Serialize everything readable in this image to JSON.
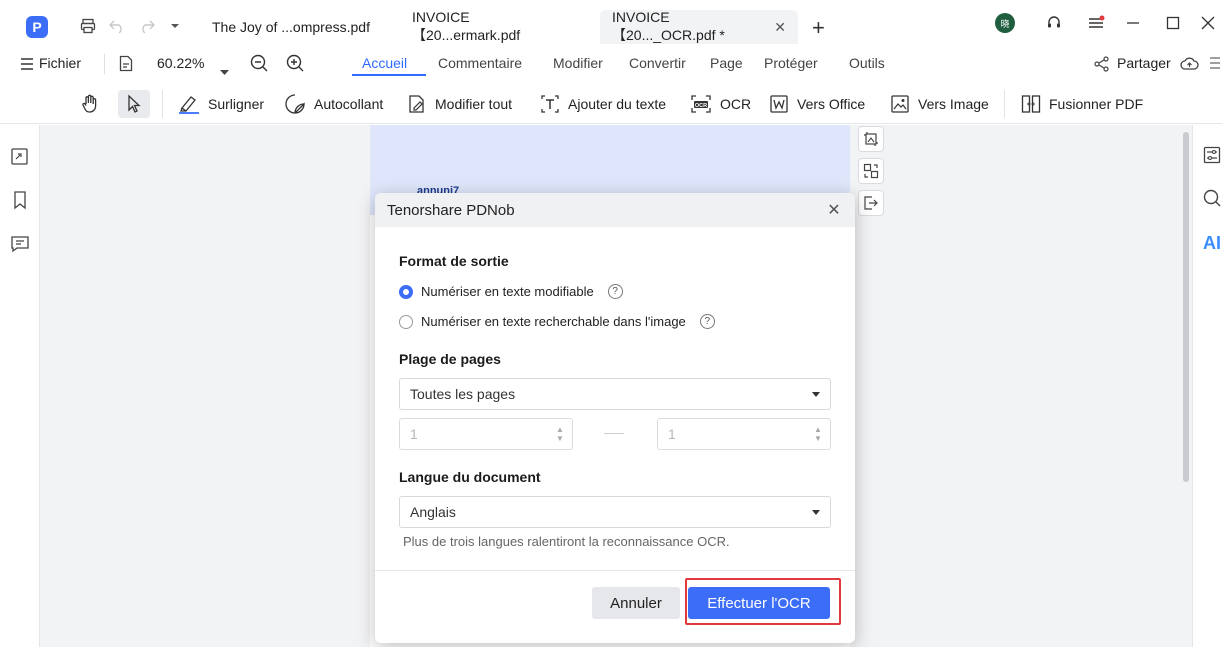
{
  "titlebar": {
    "tabs": [
      {
        "label": "The Joy of ...ompress.pdf",
        "active": false
      },
      {
        "label": "INVOICE【20...ermark.pdf",
        "active": false
      },
      {
        "label": "INVOICE【20..._OCR.pdf *",
        "active": true
      }
    ],
    "avatar_text": "晓"
  },
  "menu": {
    "file_label": "Fichier",
    "zoom_value": "60.22%",
    "tabs": [
      "Accueil",
      "Commentaire",
      "Modifier",
      "Convertir",
      "Page",
      "Protéger",
      "Outils"
    ],
    "share_label": "Partager"
  },
  "toolbar": {
    "tools": [
      "Surligner",
      "Autocollant",
      "Modifier tout",
      "Ajouter du texte",
      "OCR",
      "Vers Office",
      "Vers Image",
      "Fusionner PDF"
    ]
  },
  "page": {
    "partial_text": "annuni7"
  },
  "dialog": {
    "title": "Tenorshare PDNob",
    "output_format_title": "Format de sortie",
    "option_editable": "Numériser en texte modifiable",
    "option_searchable": "Numériser en texte recherchable dans l'image",
    "help_glyph": "?",
    "page_range_title": "Plage de pages",
    "page_range_value": "Toutes les pages",
    "from_page": "1",
    "to_page": "1",
    "language_title": "Langue du document",
    "language_value": "Anglais",
    "language_hint": "Plus de trois langues ralentiront la reconnaissance OCR.",
    "cancel_label": "Annuler",
    "run_label": "Effectuer l'OCR"
  },
  "right_rail": {
    "ai_label": "AI"
  },
  "colors": {
    "accent": "#3b6df6",
    "highlight": "#e0393e"
  }
}
